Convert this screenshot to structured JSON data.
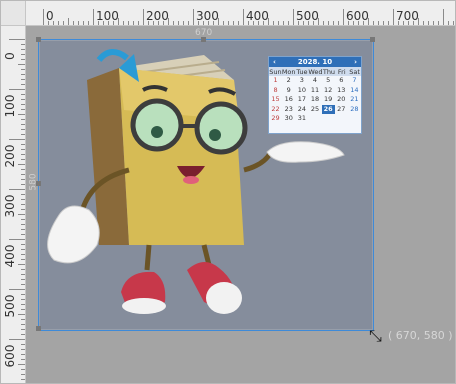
{
  "ruler_top_labels": [
    "0",
    "100",
    "200",
    "300",
    "400",
    "500",
    "600",
    "700"
  ],
  "ruler_left_labels": [
    "0",
    "100",
    "200",
    "300",
    "400",
    "500",
    "600"
  ],
  "canvas_width_label": "670",
  "canvas_height_label": "580",
  "cursor_coords": "( 670, 580 )",
  "calendar": {
    "prev": "‹",
    "title": "2028. 10",
    "next": "›",
    "weekdays": [
      "Sun",
      "Mon",
      "Tue",
      "Wed",
      "Thu",
      "Fri",
      "Sat"
    ],
    "days": [
      "1",
      "2",
      "3",
      "4",
      "5",
      "6",
      "7",
      "8",
      "9",
      "10",
      "11",
      "12",
      "13",
      "14",
      "15",
      "16",
      "17",
      "18",
      "19",
      "20",
      "21",
      "22",
      "23",
      "24",
      "25",
      "26",
      "27",
      "28",
      "29",
      "30",
      "31"
    ],
    "selected": "26"
  },
  "colors": {
    "selection_border": "#3e8ad8",
    "calendar_header": "#2f6fb8"
  },
  "icons": {
    "resize": "resize-diagonal-icon"
  }
}
